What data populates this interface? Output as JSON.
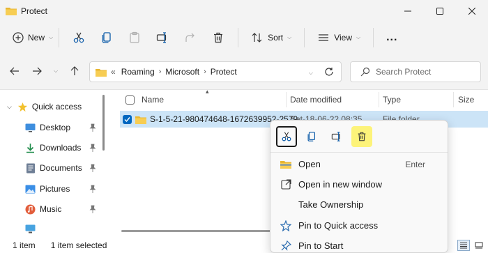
{
  "window": {
    "title": "Protect"
  },
  "toolbar": {
    "new_label": "New",
    "sort_label": "Sort",
    "view_label": "View",
    "more_label": "..."
  },
  "address": {
    "overflow": "«",
    "crumbs": [
      "Roaming",
      "Microsoft",
      "Protect"
    ]
  },
  "search": {
    "placeholder": "Search Protect"
  },
  "nav": {
    "quick_access": "Quick access",
    "items": [
      {
        "label": "Desktop",
        "icon": "desktop-icon"
      },
      {
        "label": "Downloads",
        "icon": "downloads-icon"
      },
      {
        "label": "Documents",
        "icon": "documents-icon"
      },
      {
        "label": "Pictures",
        "icon": "pictures-icon"
      },
      {
        "label": "Music",
        "icon": "music-icon"
      }
    ]
  },
  "columns": {
    "name": "Name",
    "date": "Date modified",
    "type": "Type",
    "size": "Size"
  },
  "files": [
    {
      "name": "S-1-5-21-980474648-1672639952-2579",
      "date": "Sat-18-06-22 08:35",
      "type": "File folder"
    }
  ],
  "status": {
    "count": "1 item",
    "selected": "1 item selected"
  },
  "context_menu": {
    "items": [
      {
        "label": "Open",
        "shortcut": "Enter",
        "icon": "open-folder-icon"
      },
      {
        "label": "Open in new window",
        "shortcut": "",
        "icon": "open-new-window-icon"
      },
      {
        "label": "Take Ownership",
        "shortcut": "",
        "icon": ""
      },
      {
        "label": "Pin to Quick access",
        "shortcut": "",
        "icon": "star-icon"
      },
      {
        "label": "Pin to Start",
        "shortcut": "",
        "icon": "pin-icon"
      }
    ]
  },
  "colors": {
    "accent": "#0067c0",
    "selection": "#cce4f7",
    "folder": "#f4c542",
    "highlight": "#fdf37a"
  }
}
